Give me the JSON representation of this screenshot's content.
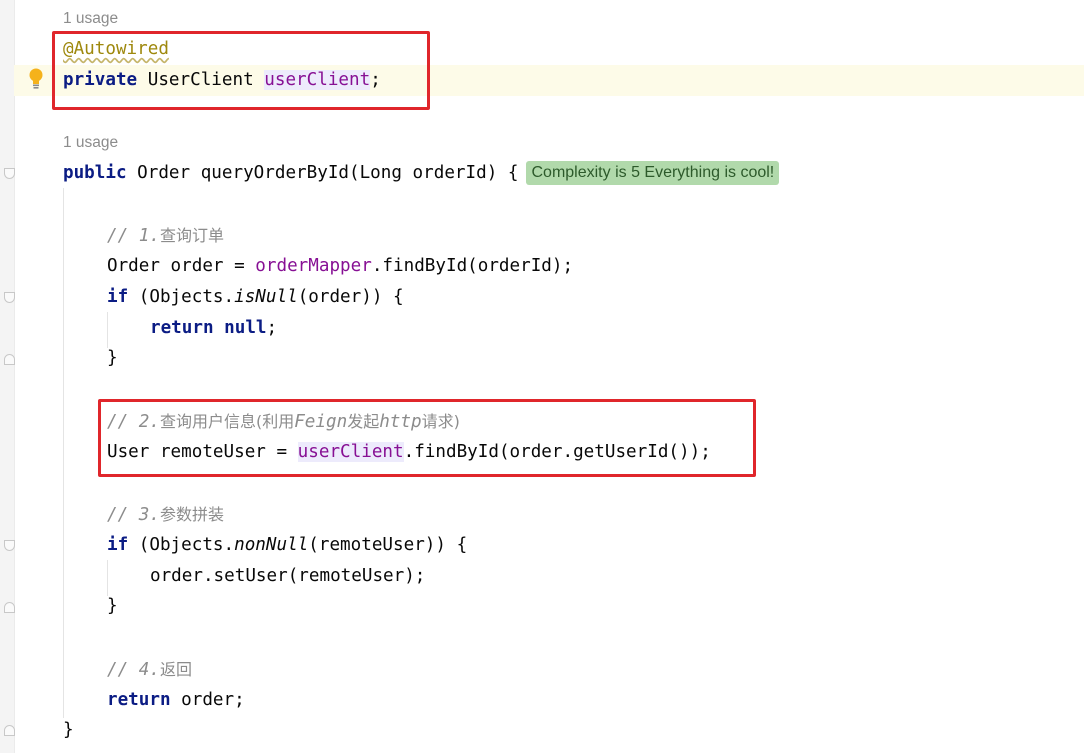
{
  "editor": {
    "field_block": {
      "usage": "1 usage",
      "annotation": "@Autowired",
      "kw_private": "private",
      "type": " UserClient ",
      "field_name": "userClient",
      "semicolon": ";"
    },
    "method_block": {
      "usage": "1 usage",
      "kw_public": "public",
      "signature": " Order queryOrderById(Long orderId) {",
      "complexity_hint": "Complexity is 5 Everything is cool!"
    },
    "body": {
      "c1_prefix": "// 1.",
      "c1_text": "查询订单",
      "l_order_a": "Order order = ",
      "l_order_field": "orderMapper",
      "l_order_b": ".findById(orderId);",
      "if1_kw": "if",
      "if1_a": " (Objects.",
      "if1_method": "isNull",
      "if1_b": "(order)) {",
      "ret_kw": "return",
      "ret_sp": " ",
      "null_kw": "null",
      "ret_end": ";",
      "close1": "}",
      "c2_prefix": "// 2.",
      "c2_cn1": "查询用户信息(利用",
      "c2_feign": "Feign",
      "c2_cn2": "发起",
      "c2_http": "http",
      "c2_cn3": "请求)",
      "remote_a": "User remoteUser = ",
      "remote_field": "userClient",
      "remote_b": ".findById(order.getUserId());",
      "c3_prefix": "// 3.",
      "c3_text": "参数拼装",
      "if2_kw": "if",
      "if2_a": " (Objects.",
      "if2_method": "nonNull",
      "if2_b": "(remoteUser)) {",
      "set_user": "order.setUser(remoteUser);",
      "close2": "}",
      "c4_prefix": "// 4.",
      "c4_text": "返回",
      "ret2_kw": "return",
      "ret2_b": " order;",
      "close_method": "}"
    }
  },
  "colors": {
    "keyword": "#0b1c84",
    "annotation": "#9e880d",
    "field": "#871094",
    "comment": "#8c8c8c",
    "highlight_box": "#e0262b",
    "hint_bg": "#b1d9ab"
  },
  "icons": [
    "lightbulb-icon",
    "fold-marker-icon"
  ]
}
